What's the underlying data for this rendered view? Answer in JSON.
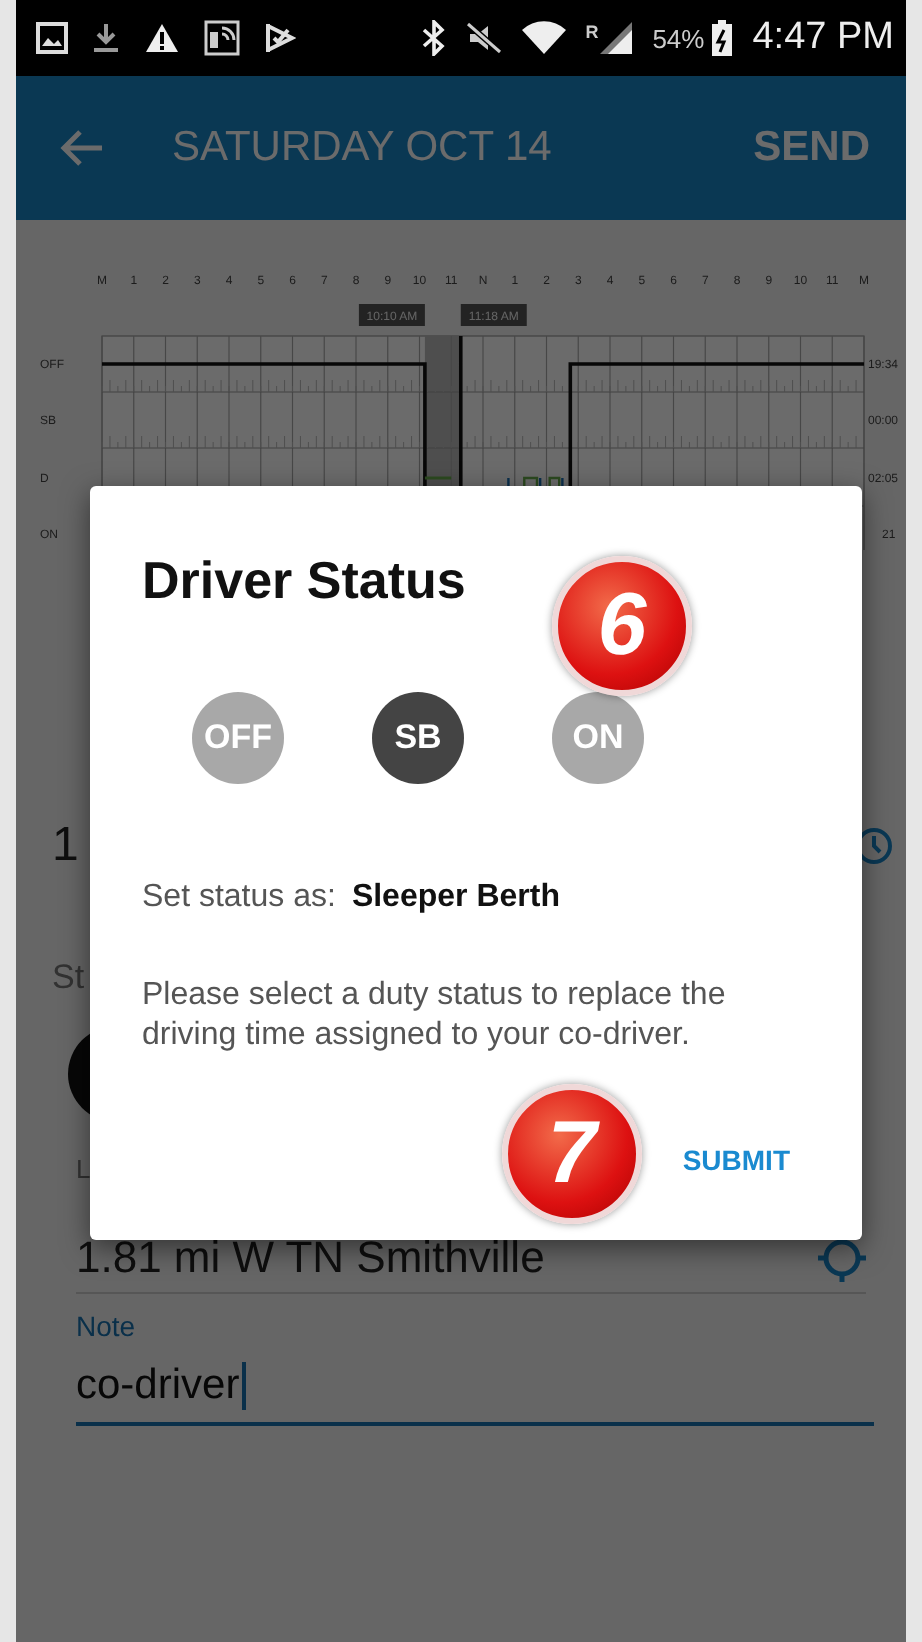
{
  "status_bar": {
    "roaming": "R",
    "battery": "54%",
    "time": "4:47 PM"
  },
  "app_bar": {
    "title": "SATURDAY OCT 14",
    "action": "SEND"
  },
  "log_chart": {
    "hour_labels": [
      "M",
      "1",
      "2",
      "3",
      "4",
      "5",
      "6",
      "7",
      "8",
      "9",
      "10",
      "11",
      "N",
      "1",
      "2",
      "3",
      "4",
      "5",
      "6",
      "7",
      "8",
      "9",
      "10",
      "11",
      "M"
    ],
    "row_labels": [
      "OFF",
      "SB",
      "D",
      "ON"
    ],
    "row_totals": [
      "19:34",
      "00:00",
      "02:05",
      "21"
    ],
    "markers": [
      "10:10 AM",
      "11:18 AM"
    ]
  },
  "form": {
    "time_value": "1",
    "status_label": "St",
    "location_label": "L",
    "location_value": "1.81 mi W TN Smithville",
    "note_label": "Note",
    "note_value": "co-driver"
  },
  "dialog": {
    "title": "Driver Status",
    "statuses": [
      {
        "label": "OFF",
        "selected": false
      },
      {
        "label": "SB",
        "selected": true
      },
      {
        "label": "ON",
        "selected": false
      }
    ],
    "set_status_label": "Set status as:",
    "set_status_value": "Sleeper Berth",
    "message": "Please select a duty status to replace the driving time assigned to your co-driver.",
    "submit": "SUBMIT"
  },
  "callouts": [
    "6",
    "7"
  ]
}
